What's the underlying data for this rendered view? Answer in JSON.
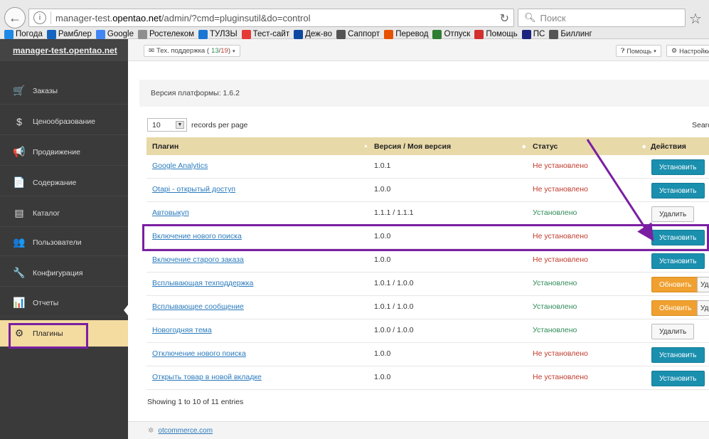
{
  "browser": {
    "url_prefix": "manager-test.",
    "url_host": "opentao.net",
    "url_path": "/admin/?cmd=pluginsutil&do=control",
    "search_placeholder": "Поиск",
    "bookmarks": [
      {
        "label": "Погода",
        "color": "#1e88e5",
        "icon": "weather-icon"
      },
      {
        "label": "Рамблер",
        "color": "#1565c0",
        "icon": "rambler-icon"
      },
      {
        "label": "Google",
        "color": "#4285f4",
        "icon": "google-icon"
      },
      {
        "label": "Ростелеком",
        "color": "#8e8e8e",
        "icon": "rostelecom-icon"
      },
      {
        "label": "ТУЛЗЫ",
        "color": "#1976d2",
        "icon": "tools-icon"
      },
      {
        "label": "Тест-сайт",
        "color": "#e53935",
        "icon": "test-site-icon"
      },
      {
        "label": "Деж-во",
        "color": "#0d47a1",
        "icon": "duty-icon"
      },
      {
        "label": "Саппорт",
        "color": "#555555",
        "icon": "support-icon"
      },
      {
        "label": "Перевод",
        "color": "#e65100",
        "icon": "translate-icon"
      },
      {
        "label": "Отпуск",
        "color": "#2e7d32",
        "icon": "vacation-icon"
      },
      {
        "label": "Помощь",
        "color": "#d32f2f",
        "icon": "help-icon"
      },
      {
        "label": "ПС",
        "color": "#1a237e",
        "icon": "ps-icon"
      },
      {
        "label": "Биллинг",
        "color": "#555555",
        "icon": "billing-icon"
      }
    ]
  },
  "topbar": {
    "brand": "manager-test.opentao.net",
    "support_label": "Тех. поддержка (",
    "support_count_a": "13",
    "support_sep": " / ",
    "support_count_b": "19",
    "support_close": ")",
    "help_label": "Помощь",
    "settings_label": "Настройки"
  },
  "sidebar": {
    "items": [
      {
        "label": "Заказы",
        "icon": "cart-icon",
        "glyph": "🛒"
      },
      {
        "label": "Ценообразование",
        "icon": "dollar-icon",
        "glyph": "$"
      },
      {
        "label": "Продвижение",
        "icon": "megaphone-icon",
        "glyph": "📢"
      },
      {
        "label": "Содержание",
        "icon": "document-icon",
        "glyph": "📄"
      },
      {
        "label": "Каталог",
        "icon": "catalog-icon",
        "glyph": "▤"
      },
      {
        "label": "Пользователи",
        "icon": "users-icon",
        "glyph": "👥"
      },
      {
        "label": "Конфигурация",
        "icon": "wrench-icon",
        "glyph": "🔧"
      },
      {
        "label": "Отчеты",
        "icon": "chart-icon",
        "glyph": "📊"
      },
      {
        "label": "Плагины",
        "icon": "gear-icon",
        "glyph": "⚙"
      }
    ]
  },
  "main": {
    "platform_version": "Версия платформы: 1.6.2",
    "per_page_value": "10",
    "per_page_label": "records per page",
    "search_label": "Search",
    "columns": [
      "Плагин",
      "Версия / Моя версия",
      "Статус",
      "Действия"
    ],
    "rows": [
      {
        "name": "Google Analytics",
        "version": "1.0.1",
        "status": "Не установлено",
        "status_type": "red",
        "actions": [
          "Установить"
        ]
      },
      {
        "name": "Otapi - открытый доступ",
        "version": "1.0.0",
        "status": "Не установлено",
        "status_type": "red",
        "actions": [
          "Установить"
        ]
      },
      {
        "name": "Автовыкуп",
        "version": "1.1.1 / 1.1.1",
        "status": "Установлено",
        "status_type": "green",
        "actions": [
          "Удалить"
        ]
      },
      {
        "name": "Включение нового поиска",
        "version": "1.0.0",
        "status": "Не установлено",
        "status_type": "red",
        "actions": [
          "Установить"
        ]
      },
      {
        "name": "Включение старого заказа",
        "version": "1.0.0",
        "status": "Не установлено",
        "status_type": "red",
        "actions": [
          "Установить"
        ]
      },
      {
        "name": "Всплывающая техподдержка",
        "version": "1.0.1 / 1.0.0",
        "status": "Установлено",
        "status_type": "green",
        "actions": [
          "Обновить",
          "Удалить"
        ]
      },
      {
        "name": "Всплывающее сообщение",
        "version": "1.0.1 / 1.0.0",
        "status": "Установлено",
        "status_type": "green",
        "actions": [
          "Обновить",
          "Удалить"
        ]
      },
      {
        "name": "Новогодняя тема",
        "version": "1.0.0 / 1.0.0",
        "status": "Установлено",
        "status_type": "green",
        "actions": [
          "Удалить"
        ]
      },
      {
        "name": "Отключение нового поиска",
        "version": "1.0.0",
        "status": "Не установлено",
        "status_type": "red",
        "actions": [
          "Установить"
        ]
      },
      {
        "name": "Открыть товар в новой вкладке",
        "version": "1.0.0",
        "status": "Не установлено",
        "status_type": "red",
        "actions": [
          "Установить"
        ]
      }
    ],
    "showing": "Showing 1 to 10 of 11 entries"
  },
  "footer": {
    "link": "otcommerce.com"
  },
  "colors": {
    "annotation": "#7a1fa2",
    "install": "#1a8fae",
    "update": "#f0a030"
  }
}
